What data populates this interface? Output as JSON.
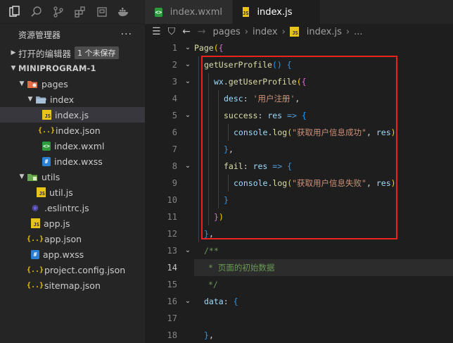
{
  "sidebar": {
    "header_title": "资源管理器",
    "more_label": "···",
    "open_editors": {
      "label": "打开的编辑器",
      "badge": "1 个未保存"
    },
    "project": {
      "label": "MINIPROGRAM-1"
    },
    "tree": [
      {
        "label": "pages",
        "kind": "folder-red",
        "expanded": true,
        "depth": 1
      },
      {
        "label": "index",
        "kind": "folder",
        "expanded": true,
        "depth": 2
      },
      {
        "label": "index.js",
        "kind": "js",
        "depth": 3,
        "selected": true
      },
      {
        "label": "index.json",
        "kind": "json",
        "depth": 3
      },
      {
        "label": "index.wxml",
        "kind": "wxml",
        "depth": 3
      },
      {
        "label": "index.wxss",
        "kind": "wxss",
        "depth": 3
      },
      {
        "label": "utils",
        "kind": "folder-green",
        "expanded": true,
        "depth": 1
      },
      {
        "label": "util.js",
        "kind": "js",
        "depth": 2
      },
      {
        "label": ".eslintrc.js",
        "kind": "eslint",
        "depth": 1
      },
      {
        "label": "app.js",
        "kind": "js",
        "depth": 1
      },
      {
        "label": "app.json",
        "kind": "json",
        "depth": 1
      },
      {
        "label": "app.wxss",
        "kind": "wxss",
        "depth": 1
      },
      {
        "label": "project.config.json",
        "kind": "json",
        "depth": 1
      },
      {
        "label": "sitemap.json",
        "kind": "json",
        "depth": 1
      }
    ]
  },
  "tabs": [
    {
      "label": "index.wxml",
      "kind": "wxml",
      "active": false
    },
    {
      "label": "index.js",
      "kind": "js",
      "active": true,
      "unsaved": true
    }
  ],
  "breadcrumb": {
    "items": [
      "pages",
      "index",
      "index.js",
      "..."
    ]
  },
  "editor": {
    "current_line": 14,
    "lines": [
      {
        "n": "1",
        "text": "Page({"
      },
      {
        "n": "2",
        "text": "getUserProfile() {"
      },
      {
        "n": "3",
        "text": "wx.getUserProfile({"
      },
      {
        "n": "4",
        "text": "desc: '用户注册',"
      },
      {
        "n": "5",
        "text": "success: res => {"
      },
      {
        "n": "6",
        "text": "console.log(\"获取用户信息成功\", res)"
      },
      {
        "n": "7",
        "text": "},"
      },
      {
        "n": "8",
        "text": "fail: res => {"
      },
      {
        "n": "9",
        "text": "console.log(\"获取用户信息失败\", res)"
      },
      {
        "n": "10",
        "text": "}"
      },
      {
        "n": "11",
        "text": "})"
      },
      {
        "n": "12",
        "text": "},"
      },
      {
        "n": "13",
        "text": "/**"
      },
      {
        "n": "14",
        "text": "* 页面的初始数据"
      },
      {
        "n": "15",
        "text": "*/"
      },
      {
        "n": "16",
        "text": "data: {"
      },
      {
        "n": "17",
        "text": ""
      },
      {
        "n": "18",
        "text": "},"
      }
    ]
  },
  "colors": {
    "highlight_box": "#e8221c",
    "keyword": "#569cd6",
    "function": "#dcdcaa",
    "string": "#ce9178",
    "comment": "#6a9955"
  }
}
